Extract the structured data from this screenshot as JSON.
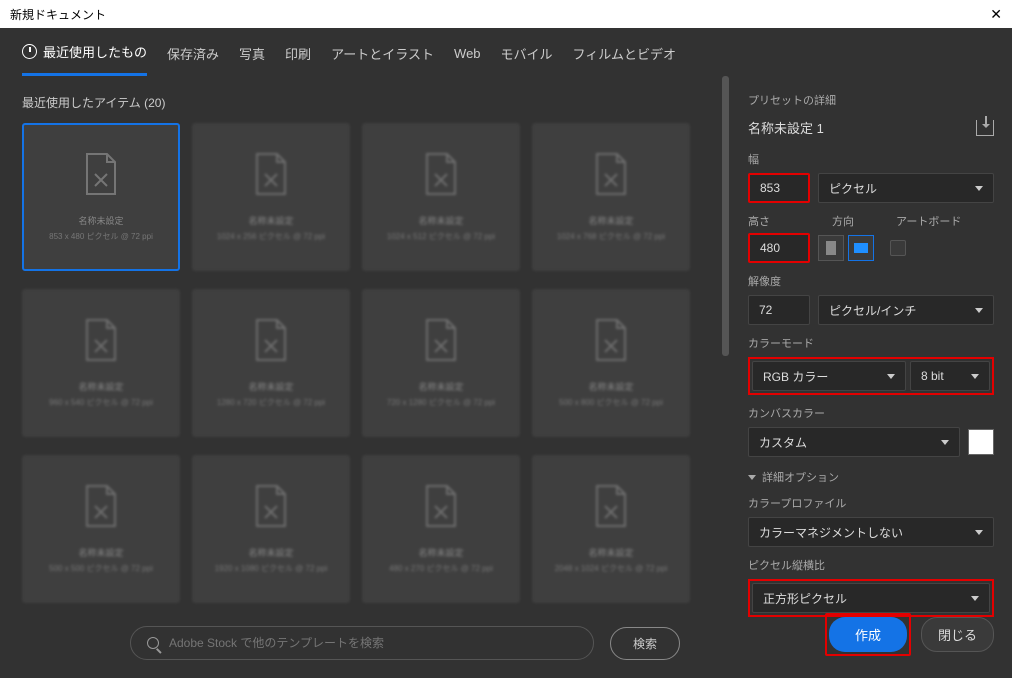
{
  "title": "新規ドキュメント",
  "tabs": [
    "最近使用したもの",
    "保存済み",
    "写真",
    "印刷",
    "アートとイラスト",
    "Web",
    "モバイル",
    "フィルムとビデオ"
  ],
  "recent_label": "最近使用したアイテム (20)",
  "cards": [
    {
      "t1": "名称未設定",
      "t2": "853 x 480 ピクセル @ 72 ppi"
    },
    {
      "t1": "名称未設定",
      "t2": "1024 x 256 ピクセル @ 72 ppi"
    },
    {
      "t1": "名称未設定",
      "t2": "1024 x 512 ピクセル @ 72 ppi"
    },
    {
      "t1": "名称未設定",
      "t2": "1024 x 768 ピクセル @ 72 ppi"
    },
    {
      "t1": "名称未設定",
      "t2": "960 x 540 ピクセル @ 72 ppi"
    },
    {
      "t1": "名称未設定",
      "t2": "1280 x 720 ピクセル @ 72 ppi"
    },
    {
      "t1": "名称未設定",
      "t2": "720 x 1280 ピクセル @ 72 ppi"
    },
    {
      "t1": "名称未設定",
      "t2": "500 x 800 ピクセル @ 72 ppi"
    },
    {
      "t1": "名称未設定",
      "t2": "500 x 500 ピクセル @ 72 ppi"
    },
    {
      "t1": "名称未設定",
      "t2": "1920 x 1080 ピクセル @ 72 ppi"
    },
    {
      "t1": "名称未設定",
      "t2": "480 x 270 ピクセル @ 72 ppi"
    },
    {
      "t1": "名称未設定",
      "t2": "2048 x 1024 ピクセル @ 72 ppi"
    }
  ],
  "search_placeholder": "Adobe Stock で他のテンプレートを検索",
  "search_button": "検索",
  "preset": {
    "heading": "プリセットの詳細",
    "name": "名称未設定 1",
    "width_label": "幅",
    "width_value": "853",
    "width_unit": "ピクセル",
    "height_label": "高さ",
    "height_value": "480",
    "orientation_label": "方向",
    "artboard_label": "アートボード",
    "resolution_label": "解像度",
    "resolution_value": "72",
    "resolution_unit": "ピクセル/インチ",
    "colormode_label": "カラーモード",
    "colormode_value": "RGB カラー",
    "colordepth_value": "8 bit",
    "canvas_label": "カンバスカラー",
    "canvas_value": "カスタム",
    "advanced_label": "詳細オプション",
    "profile_label": "カラープロファイル",
    "profile_value": "カラーマネジメントしない",
    "aspect_label": "ピクセル縦横比",
    "aspect_value": "正方形ピクセル"
  },
  "footer": {
    "create": "作成",
    "close": "閉じる"
  }
}
